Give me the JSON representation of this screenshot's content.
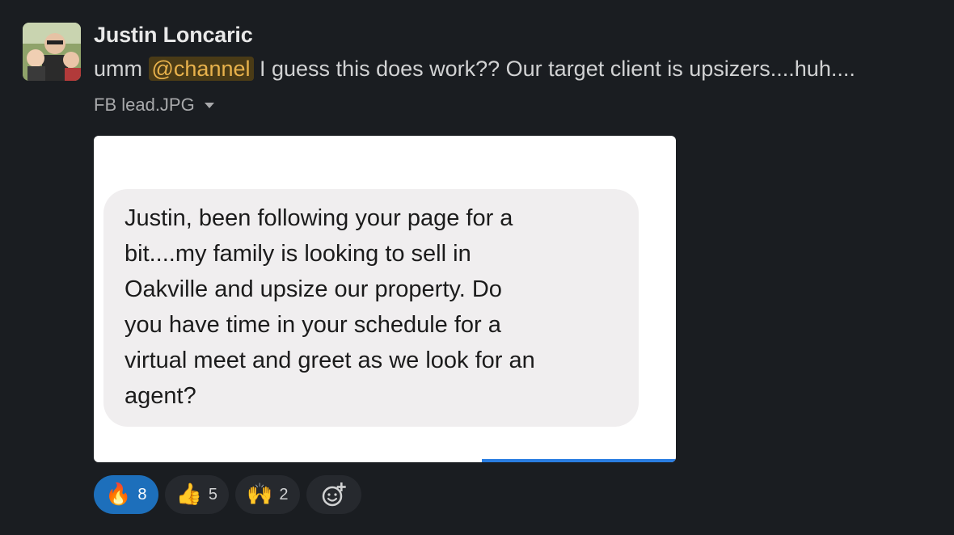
{
  "message": {
    "author": "Justin Loncaric",
    "text_before": "umm ",
    "mention": "@channel",
    "text_after": " I guess this does work??  Our target client is upsizers....huh....",
    "file_name": "FB lead.JPG",
    "image_text": "Justin, been following your page for a\nbit....my family is looking to sell in\nOakville and upsize our property.   Do\nyou have time in your schedule for a\nvirtual meet and greet as we look for an\nagent?"
  },
  "reactions": [
    {
      "icon": "fire-emoji",
      "count": "8",
      "active": true
    },
    {
      "icon": "thumbs-up-emoji",
      "count": "5",
      "active": false
    },
    {
      "icon": "raised-hands-emoji",
      "count": "2",
      "active": false
    }
  ],
  "colors": {
    "background": "#1a1d21",
    "mention_bg": "#4a3b16",
    "mention_fg": "#e8b24c",
    "active_reaction": "#1d6fbb"
  }
}
